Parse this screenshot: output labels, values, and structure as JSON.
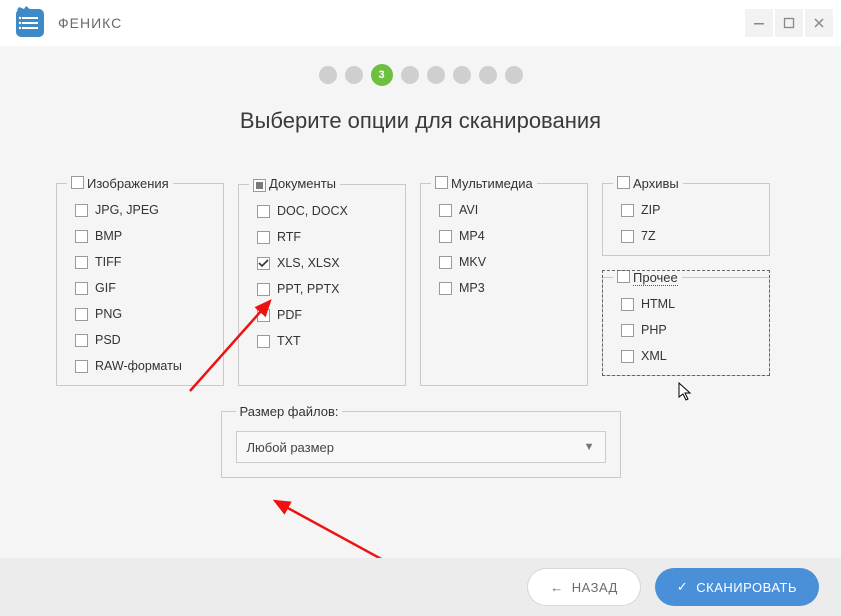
{
  "app": {
    "title": "ФЕНИКС"
  },
  "stepper": {
    "total": 8,
    "current_index": 2,
    "current_label": "3"
  },
  "page_title": "Выберите опции для сканирования",
  "groups": {
    "images": {
      "title": "Изображения",
      "header_state": "unchecked",
      "items": [
        {
          "label": "JPG, JPEG",
          "checked": false
        },
        {
          "label": "BMP",
          "checked": false
        },
        {
          "label": "TIFF",
          "checked": false
        },
        {
          "label": "GIF",
          "checked": false
        },
        {
          "label": "PNG",
          "checked": false
        },
        {
          "label": "PSD",
          "checked": false
        },
        {
          "label": "RAW-форматы",
          "checked": false
        }
      ]
    },
    "documents": {
      "title": "Документы",
      "header_state": "indeterminate",
      "items": [
        {
          "label": "DOC, DOCX",
          "checked": false
        },
        {
          "label": "RTF",
          "checked": false
        },
        {
          "label": "XLS, XLSX",
          "checked": true
        },
        {
          "label": "PPT, PPTX",
          "checked": false
        },
        {
          "label": "PDF",
          "checked": false
        },
        {
          "label": "TXT",
          "checked": false
        }
      ]
    },
    "multimedia": {
      "title": "Мультимедиа",
      "header_state": "unchecked",
      "items": [
        {
          "label": "AVI",
          "checked": false
        },
        {
          "label": "MP4",
          "checked": false
        },
        {
          "label": "MKV",
          "checked": false
        },
        {
          "label": "MP3",
          "checked": false
        }
      ]
    },
    "archives": {
      "title": "Архивы",
      "header_state": "unchecked",
      "items": [
        {
          "label": "ZIP",
          "checked": false
        },
        {
          "label": "7Z",
          "checked": false
        }
      ]
    },
    "other": {
      "title": "Прочее",
      "header_state": "unchecked",
      "highlighted": true,
      "items": [
        {
          "label": "HTML",
          "checked": false
        },
        {
          "label": "PHP",
          "checked": false
        },
        {
          "label": "XML",
          "checked": false
        }
      ]
    }
  },
  "file_size": {
    "legend": "Размер файлов:",
    "selected": "Любой размер"
  },
  "buttons": {
    "back": "НАЗАД",
    "scan": "СКАНИРОВАТЬ"
  }
}
